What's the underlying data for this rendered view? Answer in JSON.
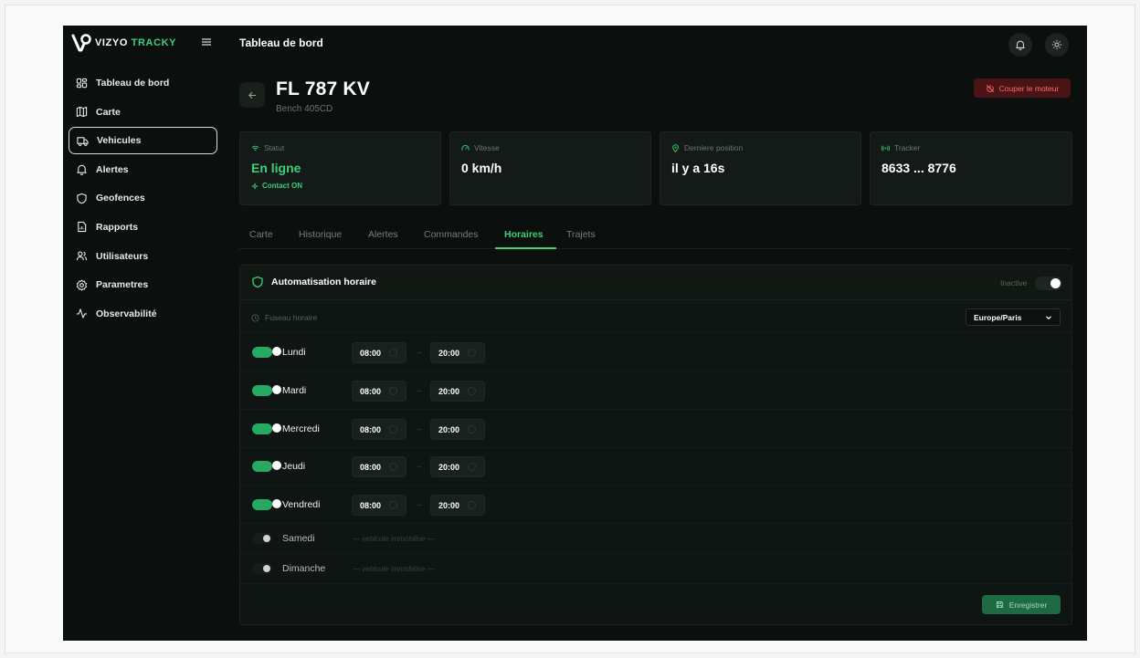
{
  "brand": {
    "name_part1": "VIZYO",
    "name_part2": "TRACKY",
    "accent": "#3ecf7a"
  },
  "header": {
    "title": "Tableau de bord"
  },
  "sidebar": {
    "items": [
      {
        "label": "Tableau de bord",
        "icon": "dashboard-icon"
      },
      {
        "label": "Carte",
        "icon": "map-icon"
      },
      {
        "label": "Vehicules",
        "icon": "truck-icon",
        "active": true
      },
      {
        "label": "Alertes",
        "icon": "bell-icon"
      },
      {
        "label": "Geofences",
        "icon": "shield-icon"
      },
      {
        "label": "Rapports",
        "icon": "report-icon"
      },
      {
        "label": "Utilisateurs",
        "icon": "users-icon"
      },
      {
        "label": "Parametres",
        "icon": "gear-icon"
      },
      {
        "label": "Observabilité",
        "icon": "activity-icon"
      }
    ]
  },
  "vehicle": {
    "plate": "FL 787 KV",
    "model": "Bench 405CD",
    "cut_engine_label": "Couper le moteur"
  },
  "stats": {
    "status": {
      "label": "Statut",
      "value": "En ligne",
      "sub": "Contact ON"
    },
    "speed": {
      "label": "Vitesse",
      "value": "0 km/h"
    },
    "position": {
      "label": "Derniere position",
      "value": "il y a 16s"
    },
    "tracker": {
      "label": "Tracker",
      "value": "8633 ... 8776"
    }
  },
  "tabs": [
    "Carte",
    "Historique",
    "Alertes",
    "Commandes",
    "Horaires",
    "Trajets"
  ],
  "active_tab": "Horaires",
  "automation": {
    "title": "Automatisation horaire",
    "state_label": "Inactive",
    "timezone_label": "Fuseau horaire",
    "timezone_value": "Europe/Paris",
    "arrow": "→",
    "days": [
      {
        "name": "Lundi",
        "enabled": true,
        "start": "08:00",
        "end": "20:00"
      },
      {
        "name": "Mardi",
        "enabled": true,
        "start": "08:00",
        "end": "20:00"
      },
      {
        "name": "Mercredi",
        "enabled": true,
        "start": "08:00",
        "end": "20:00"
      },
      {
        "name": "Jeudi",
        "enabled": true,
        "start": "08:00",
        "end": "20:00"
      },
      {
        "name": "Vendredi",
        "enabled": true,
        "start": "08:00",
        "end": "20:00"
      },
      {
        "name": "Samedi",
        "enabled": false,
        "note": "— vehicule immobilise —"
      },
      {
        "name": "Dimanche",
        "enabled": false,
        "note": "— vehicule immobilise —"
      }
    ],
    "save_label": "Enregistrer"
  }
}
